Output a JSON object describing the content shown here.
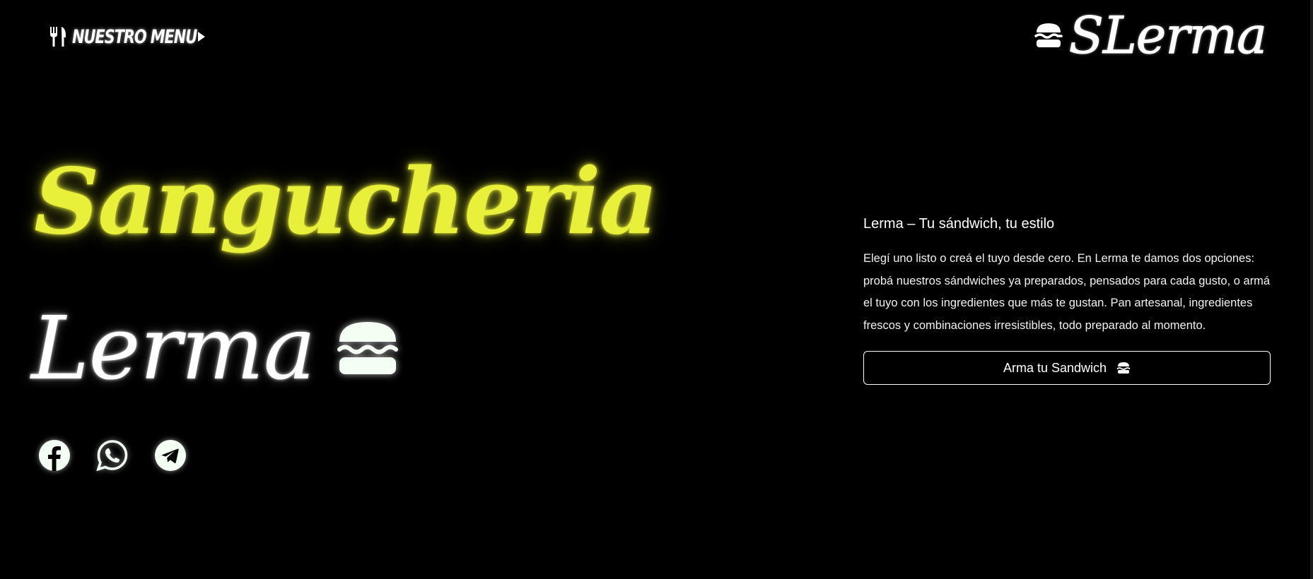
{
  "header": {
    "menu_label": "NUESTRO MENU",
    "menu_icon": "cutlery-icon",
    "menu_arrow_icon": "caret-right-icon",
    "brand_icon": "burger-icon",
    "brand_text": "SLerma"
  },
  "hero": {
    "title_line1": "Sangucheria",
    "title_line2": "Lerma",
    "title_icon": "burger-icon",
    "accent_color": "#e8f03a"
  },
  "socials": [
    {
      "name": "Facebook",
      "icon": "facebook-icon"
    },
    {
      "name": "WhatsApp",
      "icon": "whatsapp-icon"
    },
    {
      "name": "Telegram",
      "icon": "telegram-icon"
    }
  ],
  "content": {
    "subtitle": "Lerma – Tu sándwich, tu estilo",
    "description": "Elegí uno listo o creá el tuyo desde cero. En Lerma te damos dos opciones: probá nuestros sándwiches ya preparados, pensados para cada gusto, o armá el tuyo con los ingredientes que más te gustan. Pan artesanal, ingredientes frescos y combinaciones irresistibles, todo preparado al momento.",
    "cta_label": "Arma tu Sandwich",
    "cta_icon": "burger-icon"
  }
}
